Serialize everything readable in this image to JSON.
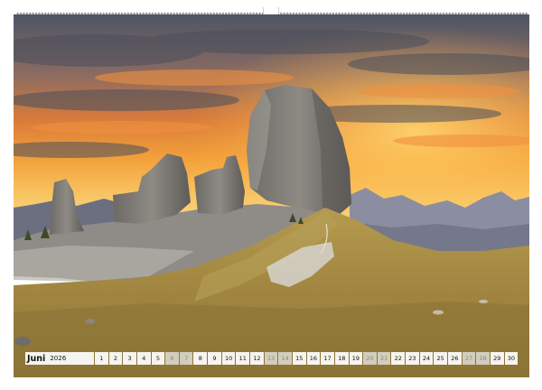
{
  "calendar": {
    "month": "Juni",
    "year": "2026",
    "days": [
      {
        "n": "1",
        "weekend": false
      },
      {
        "n": "2",
        "weekend": false
      },
      {
        "n": "3",
        "weekend": false
      },
      {
        "n": "4",
        "weekend": false
      },
      {
        "n": "5",
        "weekend": false
      },
      {
        "n": "6",
        "weekend": true
      },
      {
        "n": "7",
        "weekend": true
      },
      {
        "n": "8",
        "weekend": false
      },
      {
        "n": "9",
        "weekend": false
      },
      {
        "n": "10",
        "weekend": false
      },
      {
        "n": "11",
        "weekend": false
      },
      {
        "n": "12",
        "weekend": false
      },
      {
        "n": "13",
        "weekend": true
      },
      {
        "n": "14",
        "weekend": true
      },
      {
        "n": "15",
        "weekend": false
      },
      {
        "n": "16",
        "weekend": false
      },
      {
        "n": "17",
        "weekend": false
      },
      {
        "n": "18",
        "weekend": false
      },
      {
        "n": "19",
        "weekend": false
      },
      {
        "n": "20",
        "weekend": true
      },
      {
        "n": "21",
        "weekend": true
      },
      {
        "n": "22",
        "weekend": false
      },
      {
        "n": "23",
        "weekend": false
      },
      {
        "n": "24",
        "weekend": false
      },
      {
        "n": "25",
        "weekend": false
      },
      {
        "n": "26",
        "weekend": false
      },
      {
        "n": "27",
        "weekend": true
      },
      {
        "n": "28",
        "weekend": true
      },
      {
        "n": "29",
        "weekend": false
      },
      {
        "n": "30",
        "weekend": false
      }
    ]
  },
  "colors": {
    "sky_top": "#5b5f6e",
    "sky_glow": "#f4a63a",
    "rock": "#7d7a76",
    "meadow": "#a38a45"
  }
}
